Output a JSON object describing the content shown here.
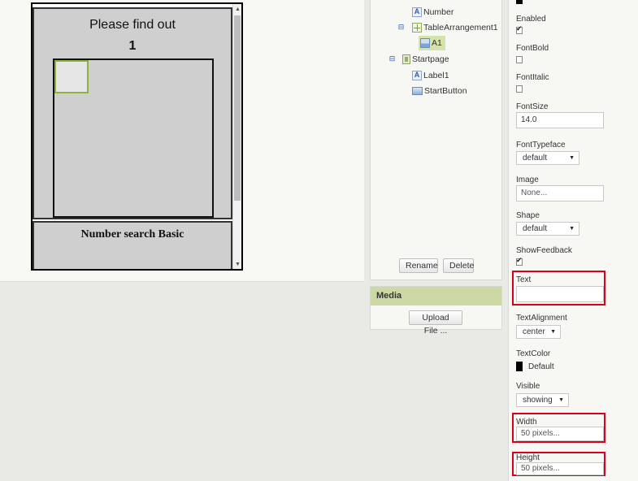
{
  "viewer": {
    "title_label": "Please find out",
    "number_label": "1",
    "startpage_label": "Number search Basic",
    "scroll_up": "▲",
    "scroll_down": "▼"
  },
  "components": {
    "items": [
      {
        "label": "Number",
        "icon": "label-icon"
      },
      {
        "label": "TableArrangement1",
        "icon": "table-arrangement-icon",
        "toggle": "⊟"
      },
      {
        "label": "A1",
        "icon": "image-icon",
        "selected": true
      },
      {
        "label": "Startpage",
        "icon": "vertical-arrangement-icon",
        "toggle": "⊟"
      },
      {
        "label": "Label1",
        "icon": "label-icon"
      },
      {
        "label": "StartButton",
        "icon": "button-icon"
      }
    ],
    "rename_label": "Rename",
    "delete_label": "Delete"
  },
  "media": {
    "header": "Media",
    "upload_label": "Upload File ..."
  },
  "properties": {
    "enabled": {
      "label": "Enabled",
      "checked": true
    },
    "fontbold": {
      "label": "FontBold",
      "checked": false
    },
    "fontitalic": {
      "label": "FontItalic",
      "checked": false
    },
    "fontsize": {
      "label": "FontSize",
      "value": "14.0"
    },
    "fonttypeface": {
      "label": "FontTypeface",
      "value": "default"
    },
    "image": {
      "label": "Image",
      "value": "None..."
    },
    "shape": {
      "label": "Shape",
      "value": "default"
    },
    "showfeedback": {
      "label": "ShowFeedback",
      "checked": true
    },
    "text": {
      "label": "Text",
      "value": ""
    },
    "textalignment": {
      "label": "TextAlignment",
      "value": "center"
    },
    "textcolor": {
      "label": "TextColor",
      "value": "Default"
    },
    "visible": {
      "label": "Visible",
      "value": "showing"
    },
    "width": {
      "label": "Width",
      "value": "50 pixels..."
    },
    "height": {
      "label": "Height",
      "value": "50 pixels..."
    },
    "caret": "▼"
  },
  "colors": {
    "highlight": "#d9001b",
    "selected": "#d4e3a9",
    "media_header": "#cdd9a5",
    "cell_border": "#8fb33a"
  }
}
